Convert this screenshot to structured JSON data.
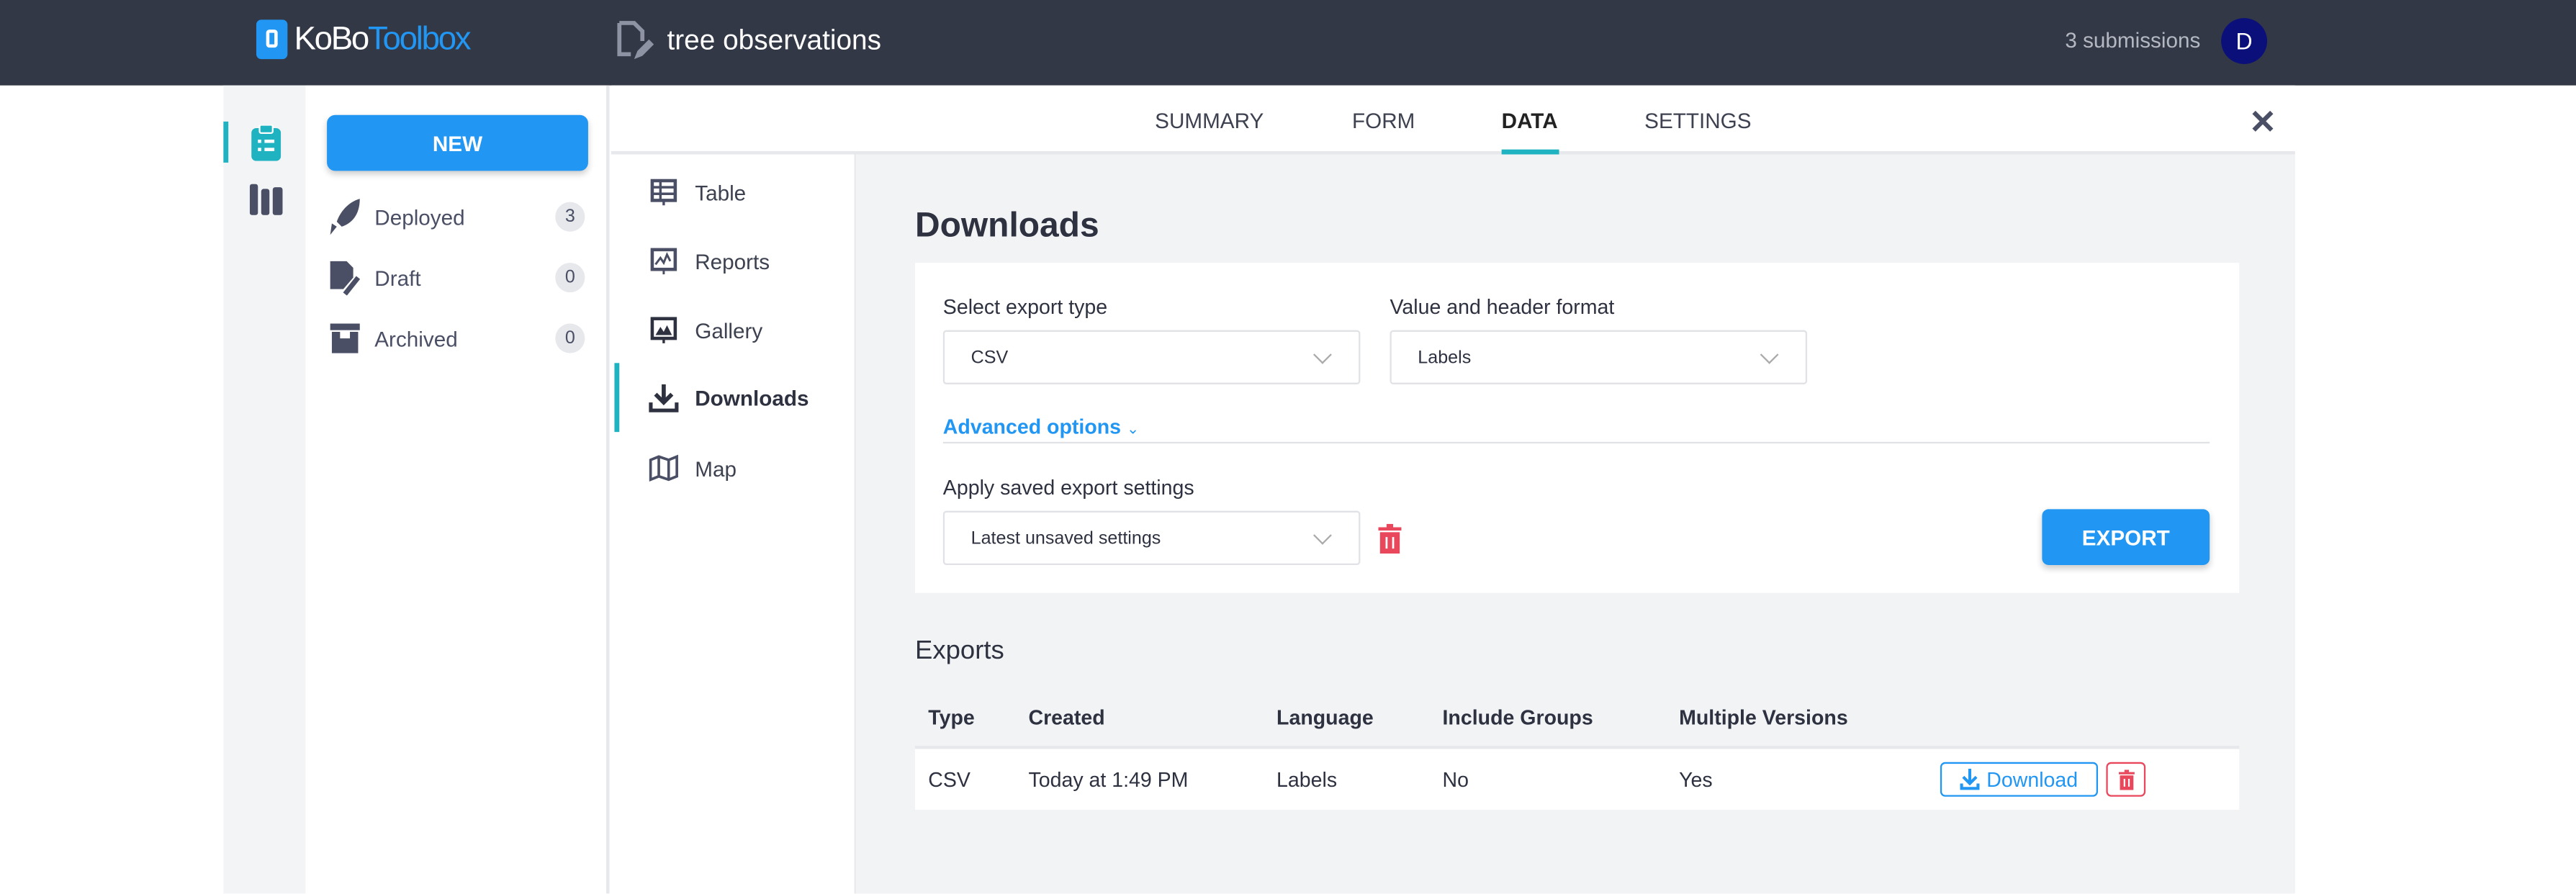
{
  "header": {
    "logo_part1": "KoBo",
    "logo_part2": "Toolbox",
    "form_title": "tree observations",
    "submissions": "3 submissions",
    "avatar_initial": "D"
  },
  "sidebar": {
    "new_label": "NEW",
    "items": [
      {
        "label": "Deployed",
        "count": "3"
      },
      {
        "label": "Draft",
        "count": "0"
      },
      {
        "label": "Archived",
        "count": "0"
      }
    ]
  },
  "tabs": [
    "SUMMARY",
    "FORM",
    "DATA",
    "SETTINGS"
  ],
  "active_tab": "DATA",
  "subnav": {
    "items": [
      "Table",
      "Reports",
      "Gallery",
      "Downloads",
      "Map"
    ],
    "active": "Downloads"
  },
  "downloads": {
    "title": "Downloads",
    "export_type_label": "Select export type",
    "export_type_value": "CSV",
    "format_label": "Value and header format",
    "format_value": "Labels",
    "advanced_options": "Advanced options",
    "saved_settings_label": "Apply saved export settings",
    "saved_settings_value": "Latest unsaved settings",
    "export_button": "EXPORT"
  },
  "exports": {
    "title": "Exports",
    "columns": [
      "Type",
      "Created",
      "Language",
      "Include Groups",
      "Multiple Versions"
    ],
    "rows": [
      {
        "type": "CSV",
        "created": "Today at 1:49 PM",
        "language": "Labels",
        "include_groups": "No",
        "multiple_versions": "Yes",
        "download_label": "Download"
      }
    ]
  },
  "colors": {
    "accent": "#2196f3",
    "teal": "#1fb3c1",
    "danger": "#e8475c",
    "header_bg": "#333846"
  }
}
